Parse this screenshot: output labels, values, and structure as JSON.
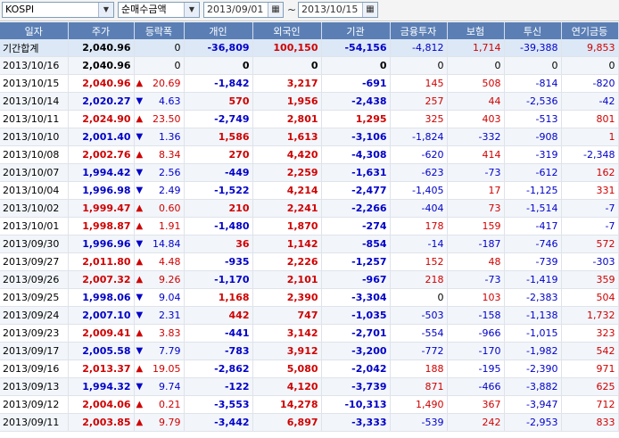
{
  "toolbar": {
    "market": "KOSPI",
    "metric": "순매수금액",
    "date_from": "2013/09/01",
    "date_to": "2013/10/15",
    "separator": "~"
  },
  "columns": [
    "일자",
    "주가",
    "등락폭",
    "개인",
    "외국인",
    "기관",
    "금융투자",
    "보험",
    "투신",
    "연기금등"
  ],
  "rows": [
    {
      "date": "기간합계",
      "price": "2,040.96",
      "dir": "",
      "chg": "0",
      "ind": "-36,809",
      "frn": "100,150",
      "inst": "-54,156",
      "fin": "-4,812",
      "ins": "1,714",
      "trust": "-39,388",
      "pens": "9,853"
    },
    {
      "date": "2013/10/16",
      "price": "2,040.96",
      "dir": "",
      "chg": "0",
      "ind": "0",
      "frn": "0",
      "inst": "0",
      "fin": "0",
      "ins": "0",
      "trust": "0",
      "pens": "0"
    },
    {
      "date": "2013/10/15",
      "price": "2,040.96",
      "dir": "up",
      "chg": "20.69",
      "ind": "-1,842",
      "frn": "3,217",
      "inst": "-691",
      "fin": "145",
      "ins": "508",
      "trust": "-814",
      "pens": "-820"
    },
    {
      "date": "2013/10/14",
      "price": "2,020.27",
      "dir": "down",
      "chg": "4.63",
      "ind": "570",
      "frn": "1,956",
      "inst": "-2,438",
      "fin": "257",
      "ins": "44",
      "trust": "-2,536",
      "pens": "-42"
    },
    {
      "date": "2013/10/11",
      "price": "2,024.90",
      "dir": "up",
      "chg": "23.50",
      "ind": "-2,749",
      "frn": "2,801",
      "inst": "1,295",
      "fin": "325",
      "ins": "403",
      "trust": "-513",
      "pens": "801"
    },
    {
      "date": "2013/10/10",
      "price": "2,001.40",
      "dir": "down",
      "chg": "1.36",
      "ind": "1,586",
      "frn": "1,613",
      "inst": "-3,106",
      "fin": "-1,824",
      "ins": "-332",
      "trust": "-908",
      "pens": "1"
    },
    {
      "date": "2013/10/08",
      "price": "2,002.76",
      "dir": "up",
      "chg": "8.34",
      "ind": "270",
      "frn": "4,420",
      "inst": "-4,308",
      "fin": "-620",
      "ins": "414",
      "trust": "-319",
      "pens": "-2,348"
    },
    {
      "date": "2013/10/07",
      "price": "1,994.42",
      "dir": "down",
      "chg": "2.56",
      "ind": "-449",
      "frn": "2,259",
      "inst": "-1,631",
      "fin": "-623",
      "ins": "-73",
      "trust": "-612",
      "pens": "162"
    },
    {
      "date": "2013/10/04",
      "price": "1,996.98",
      "dir": "down",
      "chg": "2.49",
      "ind": "-1,522",
      "frn": "4,214",
      "inst": "-2,477",
      "fin": "-1,405",
      "ins": "17",
      "trust": "-1,125",
      "pens": "331"
    },
    {
      "date": "2013/10/02",
      "price": "1,999.47",
      "dir": "up",
      "chg": "0.60",
      "ind": "210",
      "frn": "2,241",
      "inst": "-2,266",
      "fin": "-404",
      "ins": "73",
      "trust": "-1,514",
      "pens": "-7"
    },
    {
      "date": "2013/10/01",
      "price": "1,998.87",
      "dir": "up",
      "chg": "1.91",
      "ind": "-1,480",
      "frn": "1,870",
      "inst": "-274",
      "fin": "178",
      "ins": "159",
      "trust": "-417",
      "pens": "-7"
    },
    {
      "date": "2013/09/30",
      "price": "1,996.96",
      "dir": "down",
      "chg": "14.84",
      "ind": "36",
      "frn": "1,142",
      "inst": "-854",
      "fin": "-14",
      "ins": "-187",
      "trust": "-746",
      "pens": "572"
    },
    {
      "date": "2013/09/27",
      "price": "2,011.80",
      "dir": "up",
      "chg": "4.48",
      "ind": "-935",
      "frn": "2,226",
      "inst": "-1,257",
      "fin": "152",
      "ins": "48",
      "trust": "-739",
      "pens": "-303"
    },
    {
      "date": "2013/09/26",
      "price": "2,007.32",
      "dir": "up",
      "chg": "9.26",
      "ind": "-1,170",
      "frn": "2,101",
      "inst": "-967",
      "fin": "218",
      "ins": "-73",
      "trust": "-1,419",
      "pens": "359"
    },
    {
      "date": "2013/09/25",
      "price": "1,998.06",
      "dir": "down",
      "chg": "9.04",
      "ind": "1,168",
      "frn": "2,390",
      "inst": "-3,304",
      "fin": "0",
      "ins": "103",
      "trust": "-2,383",
      "pens": "504"
    },
    {
      "date": "2013/09/24",
      "price": "2,007.10",
      "dir": "down",
      "chg": "2.31",
      "ind": "442",
      "frn": "747",
      "inst": "-1,035",
      "fin": "-503",
      "ins": "-158",
      "trust": "-1,138",
      "pens": "1,732"
    },
    {
      "date": "2013/09/23",
      "price": "2,009.41",
      "dir": "up",
      "chg": "3.83",
      "ind": "-441",
      "frn": "3,142",
      "inst": "-2,701",
      "fin": "-554",
      "ins": "-966",
      "trust": "-1,015",
      "pens": "323"
    },
    {
      "date": "2013/09/17",
      "price": "2,005.58",
      "dir": "down",
      "chg": "7.79",
      "ind": "-783",
      "frn": "3,912",
      "inst": "-3,200",
      "fin": "-772",
      "ins": "-170",
      "trust": "-1,982",
      "pens": "542"
    },
    {
      "date": "2013/09/16",
      "price": "2,013.37",
      "dir": "up",
      "chg": "19.05",
      "ind": "-2,862",
      "frn": "5,080",
      "inst": "-2,042",
      "fin": "188",
      "ins": "-195",
      "trust": "-2,390",
      "pens": "971"
    },
    {
      "date": "2013/09/13",
      "price": "1,994.32",
      "dir": "down",
      "chg": "9.74",
      "ind": "-122",
      "frn": "4,120",
      "inst": "-3,739",
      "fin": "871",
      "ins": "-466",
      "trust": "-3,882",
      "pens": "625"
    },
    {
      "date": "2013/09/12",
      "price": "2,004.06",
      "dir": "up",
      "chg": "0.21",
      "ind": "-3,553",
      "frn": "14,278",
      "inst": "-10,313",
      "fin": "1,490",
      "ins": "367",
      "trust": "-3,947",
      "pens": "712"
    },
    {
      "date": "2013/09/11",
      "price": "2,003.85",
      "dir": "up",
      "chg": "9.79",
      "ind": "-3,442",
      "frn": "6,897",
      "inst": "-3,333",
      "fin": "-539",
      "ins": "242",
      "trust": "-2,953",
      "pens": "833"
    }
  ],
  "colors": {
    "header_bg": "#5b7fb5",
    "up": "#d00000",
    "down": "#0000c8",
    "total_bg": "#dce8f6"
  },
  "icons": {
    "up": "▲",
    "down": "▼",
    "dropdown": "▼",
    "calendar": "▦"
  }
}
